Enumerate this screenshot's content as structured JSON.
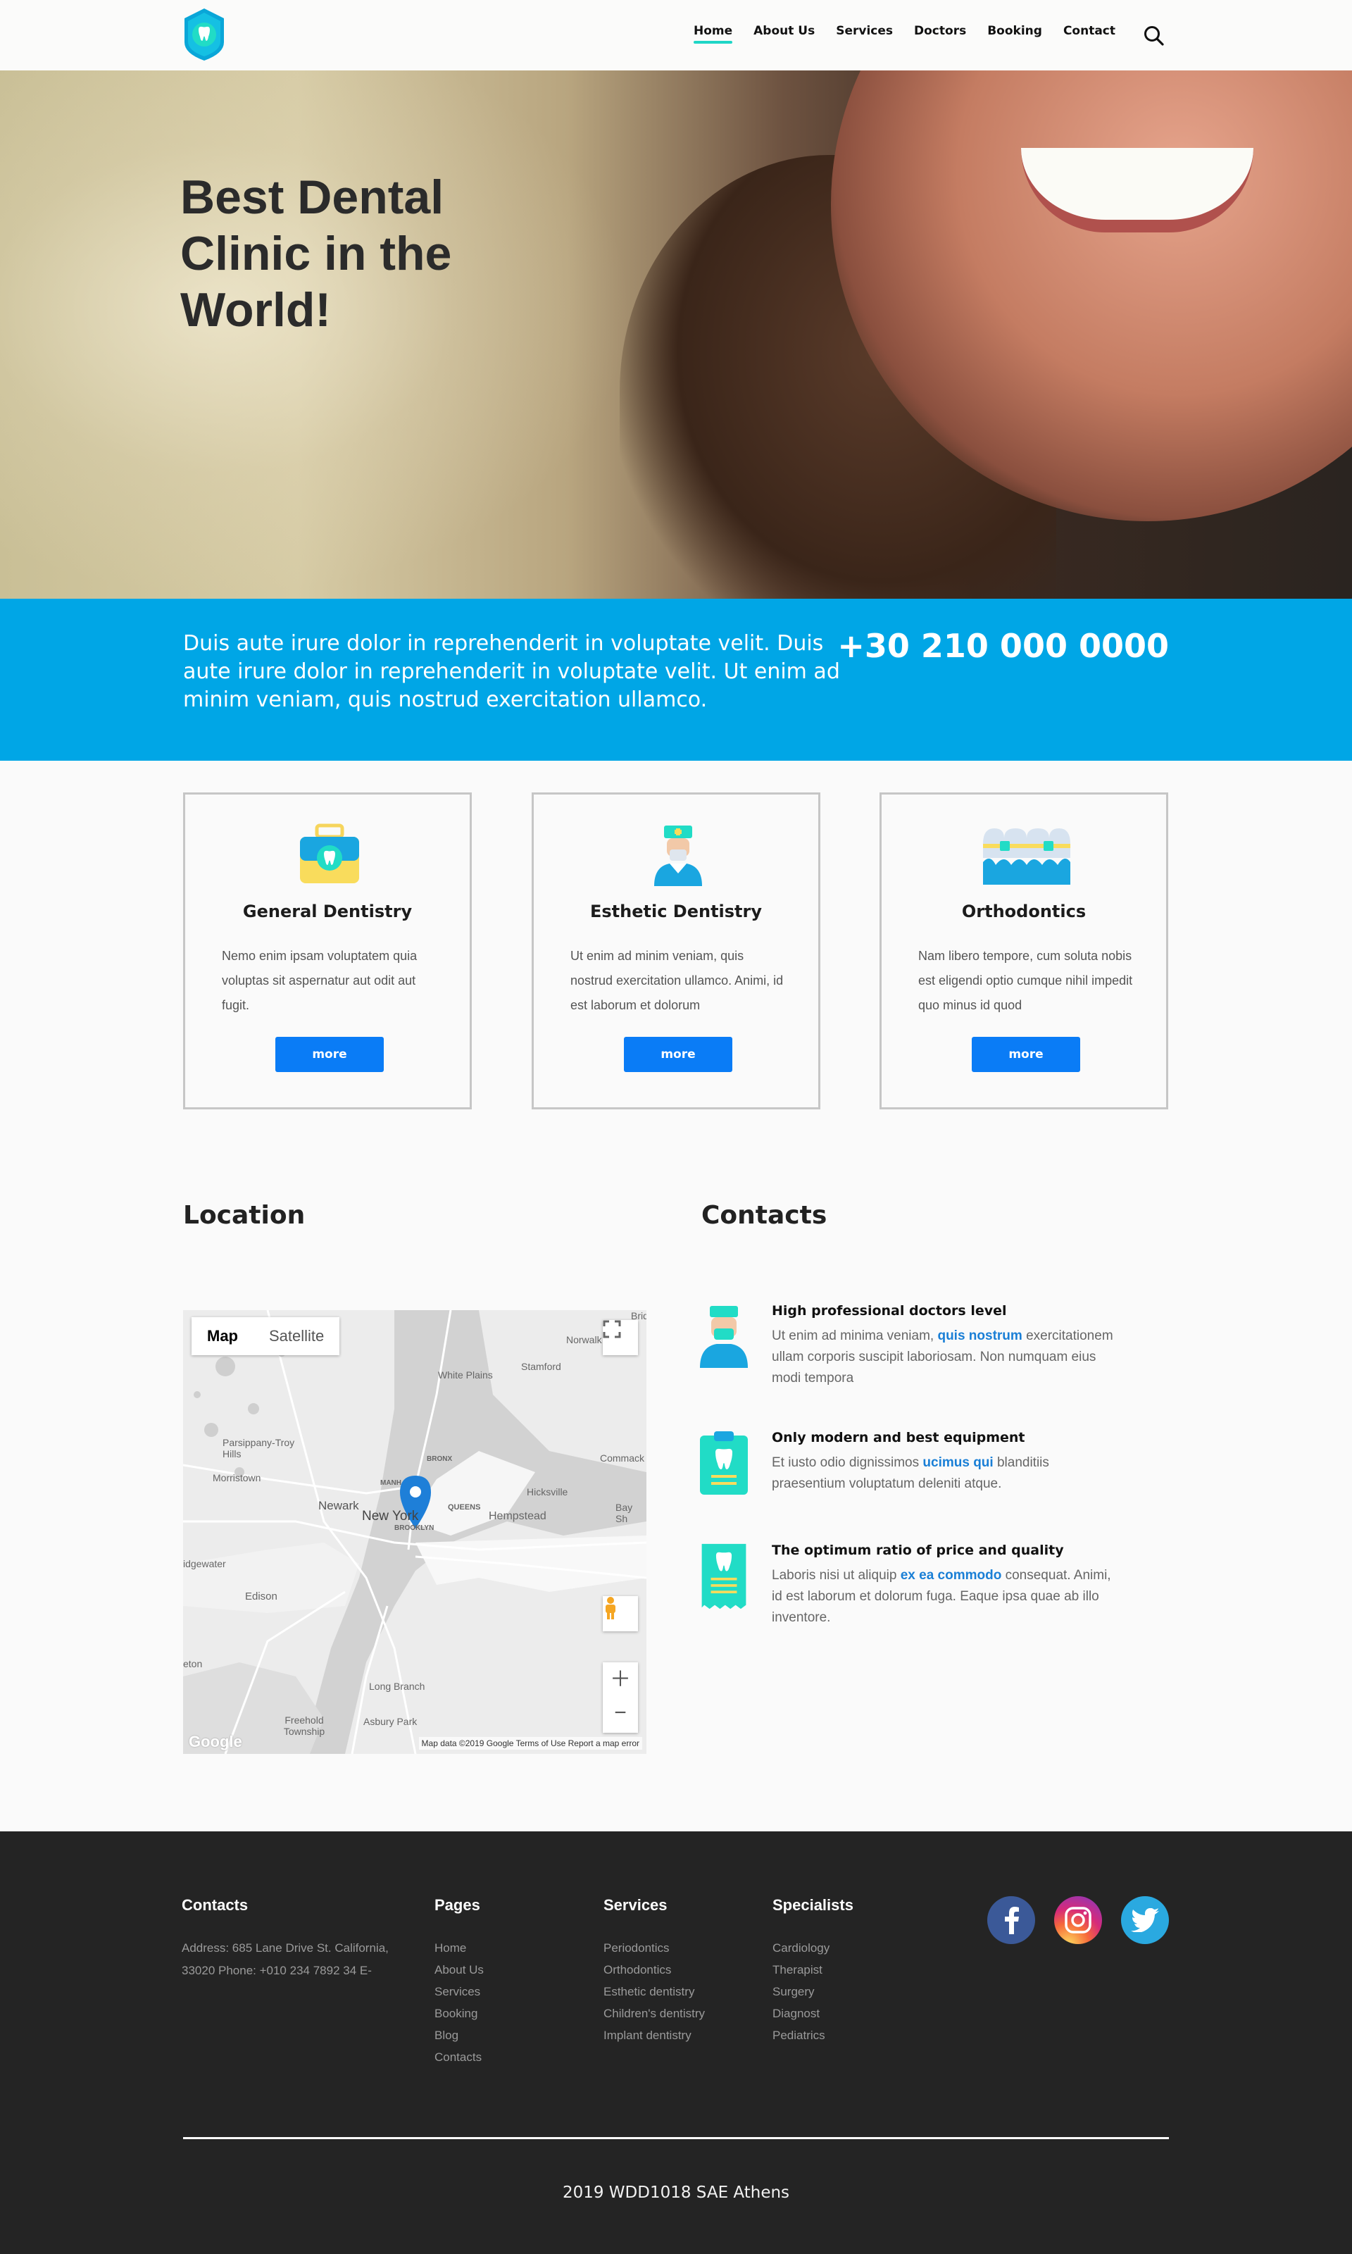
{
  "nav": {
    "items": [
      {
        "label": "Home",
        "active": true
      },
      {
        "label": "About Us"
      },
      {
        "label": "Services"
      },
      {
        "label": "Doctors"
      },
      {
        "label": "Booking"
      },
      {
        "label": "Contact"
      }
    ]
  },
  "hero": {
    "title": "Best Dental Clinic in the World!"
  },
  "band": {
    "text": "Duis aute irure dolor in reprehenderit in voluptate velit. Duis aute irure dolor in reprehenderit in voluptate velit. Ut enim ad minim veniam, quis nostrud exercitation ullamco.",
    "phone": "+30 210 000 0000"
  },
  "cards": [
    {
      "title": "General Dentistry",
      "text": "Nemo enim ipsam voluptatem quia voluptas sit aspernatur aut odit aut fugit.",
      "button": "more"
    },
    {
      "title": "Esthetic Dentistry",
      "text": "Ut enim ad minim veniam, quis nostrud exercitation ullamco. Animi, id est laborum et dolorum",
      "button": "more"
    },
    {
      "title": "Orthodontics",
      "text": "Nam libero tempore, cum soluta nobis est eligendi optio cumque nihil impedit quo minus id quod",
      "button": "more"
    }
  ],
  "location": {
    "title": "Location",
    "map": {
      "tab_map": "Map",
      "tab_satellite": "Satellite",
      "labels": [
        "White Plains",
        "Stamford",
        "Norwalk",
        "Parsippany-Troy Hills",
        "Morristown",
        "Newark",
        "New York",
        "QUEENS",
        "Hempstead",
        "Hicksville",
        "Bay Sh",
        "Commack",
        "Edison",
        "Long Branch",
        "Asbury Park",
        "Freehold Township",
        "idgewater",
        "eton",
        "BRONX",
        "MANH",
        "BROOKLYN",
        "Brid"
      ],
      "footer": "Map data ©2019 Google   Terms of Use   Report a map error",
      "google": "Google"
    }
  },
  "contacts": {
    "title": "Contacts",
    "items": [
      {
        "title": "High professional doctors level",
        "pre": "Ut enim ad minima veniam, ",
        "highlight": "quis nostrum",
        "post": " exercitationem ullam corporis suscipit laboriosam. Non numquam eius modi tempora"
      },
      {
        "title": "Only modern and best equipment",
        "pre": "Et iusto odio dignissimos ",
        "highlight": "ucimus qui",
        "post": " blanditiis praesentium voluptatum deleniti atque."
      },
      {
        "title": "The optimum ratio of price and quality",
        "pre": "Laboris nisi ut aliquip ",
        "highlight": "ex ea commodo",
        "post": " consequat. Animi, id est laborum et dolorum fuga. Eaque ipsa quae ab illo inventore."
      }
    ]
  },
  "footer": {
    "contacts": {
      "title": "Contacts",
      "address": "Address: 685 Lane Drive St. California, 33020 Phone: +010 234 7892 34 E-"
    },
    "pages": {
      "title": "Pages",
      "items": [
        "Home",
        "About Us",
        "Services",
        "Booking",
        "Blog",
        "Contacts"
      ]
    },
    "services": {
      "title": "Services",
      "items": [
        "Periodontics",
        "Orthodontics",
        "Esthetic dentistry",
        "Children's dentistry",
        "Implant dentistry"
      ]
    },
    "specialists": {
      "title": "Specialists",
      "items": [
        "Cardiology",
        "Therapist",
        "Surgery",
        "Diagnost",
        "Pediatrics"
      ]
    },
    "social": [
      "facebook-icon",
      "instagram-icon",
      "twitter-icon"
    ],
    "copyright": "2019 WDD1018 SAE Athens"
  },
  "colors": {
    "accent": "#00a6e6",
    "button": "#0a7cf6",
    "underline": "#1fd6c6",
    "footer": "#242424",
    "link": "#1a7fd6"
  }
}
